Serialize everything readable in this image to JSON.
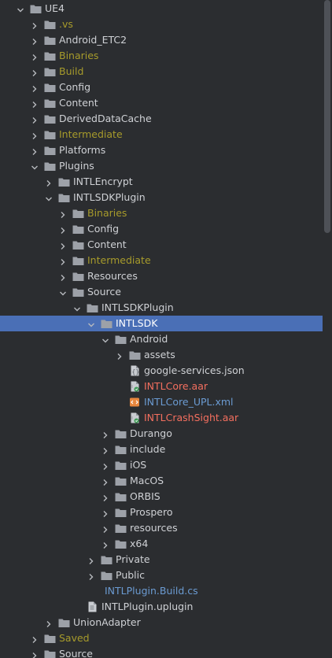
{
  "colors": {
    "background": "#2b2d30",
    "selection": "#4a6fb6",
    "text_default": "#cfd1d5",
    "text_excluded": "#a79b2b",
    "text_added": "#f46f5f",
    "text_modified": "#6b9bd2",
    "folder": "#9da1a8"
  },
  "tree": [
    {
      "label": "UE4",
      "level": 0,
      "expanded": true,
      "kind": "folder",
      "status": "default"
    },
    {
      "label": ".vs",
      "level": 1,
      "expanded": false,
      "kind": "folder",
      "status": "excluded"
    },
    {
      "label": "Android_ETC2",
      "level": 1,
      "expanded": false,
      "kind": "folder",
      "status": "default"
    },
    {
      "label": "Binaries",
      "level": 1,
      "expanded": false,
      "kind": "folder",
      "status": "excluded"
    },
    {
      "label": "Build",
      "level": 1,
      "expanded": false,
      "kind": "folder",
      "status": "excluded"
    },
    {
      "label": "Config",
      "level": 1,
      "expanded": false,
      "kind": "folder",
      "status": "default"
    },
    {
      "label": "Content",
      "level": 1,
      "expanded": false,
      "kind": "folder",
      "status": "default"
    },
    {
      "label": "DerivedDataCache",
      "level": 1,
      "expanded": false,
      "kind": "folder",
      "status": "default"
    },
    {
      "label": "Intermediate",
      "level": 1,
      "expanded": false,
      "kind": "folder",
      "status": "excluded"
    },
    {
      "label": "Platforms",
      "level": 1,
      "expanded": false,
      "kind": "folder",
      "status": "default"
    },
    {
      "label": "Plugins",
      "level": 1,
      "expanded": true,
      "kind": "folder",
      "status": "default"
    },
    {
      "label": "INTLEncrypt",
      "level": 2,
      "expanded": false,
      "kind": "folder",
      "status": "default"
    },
    {
      "label": "INTLSDKPlugin",
      "level": 2,
      "expanded": true,
      "kind": "folder",
      "status": "default"
    },
    {
      "label": "Binaries",
      "level": 3,
      "expanded": false,
      "kind": "folder",
      "status": "excluded"
    },
    {
      "label": "Config",
      "level": 3,
      "expanded": false,
      "kind": "folder",
      "status": "default"
    },
    {
      "label": "Content",
      "level": 3,
      "expanded": false,
      "kind": "folder",
      "status": "default"
    },
    {
      "label": "Intermediate",
      "level": 3,
      "expanded": false,
      "kind": "folder",
      "status": "excluded"
    },
    {
      "label": "Resources",
      "level": 3,
      "expanded": false,
      "kind": "folder",
      "status": "default"
    },
    {
      "label": "Source",
      "level": 3,
      "expanded": true,
      "kind": "folder",
      "status": "default"
    },
    {
      "label": "INTLSDKPlugin",
      "level": 4,
      "expanded": true,
      "kind": "folder",
      "status": "default"
    },
    {
      "label": "INTLSDK",
      "level": 5,
      "expanded": true,
      "kind": "folder",
      "status": "default",
      "selected": true
    },
    {
      "label": "Android",
      "level": 6,
      "expanded": true,
      "kind": "folder",
      "status": "default"
    },
    {
      "label": "assets",
      "level": 7,
      "expanded": false,
      "kind": "folder",
      "status": "default"
    },
    {
      "label": "google-services.json",
      "level": 7,
      "kind": "json",
      "status": "default"
    },
    {
      "label": "INTLCore.aar",
      "level": 7,
      "kind": "aar",
      "status": "added"
    },
    {
      "label": "INTLCore_UPL.xml",
      "level": 7,
      "kind": "xml",
      "status": "modified"
    },
    {
      "label": "INTLCrashSight.aar",
      "level": 7,
      "kind": "aar",
      "status": "added"
    },
    {
      "label": "Durango",
      "level": 6,
      "expanded": false,
      "kind": "folder",
      "status": "default"
    },
    {
      "label": "include",
      "level": 6,
      "expanded": false,
      "kind": "folder",
      "status": "default"
    },
    {
      "label": "iOS",
      "level": 6,
      "expanded": false,
      "kind": "folder",
      "status": "default"
    },
    {
      "label": "MacOS",
      "level": 6,
      "expanded": false,
      "kind": "folder",
      "status": "default"
    },
    {
      "label": "ORBIS",
      "level": 6,
      "expanded": false,
      "kind": "folder",
      "status": "default"
    },
    {
      "label": "Prospero",
      "level": 6,
      "expanded": false,
      "kind": "folder",
      "status": "default"
    },
    {
      "label": "resources",
      "level": 6,
      "expanded": false,
      "kind": "folder",
      "status": "default"
    },
    {
      "label": "x64",
      "level": 6,
      "expanded": false,
      "kind": "folder",
      "status": "default"
    },
    {
      "label": "Private",
      "level": 5,
      "expanded": false,
      "kind": "folder",
      "status": "default"
    },
    {
      "label": "Public",
      "level": 5,
      "expanded": false,
      "kind": "folder",
      "status": "default"
    },
    {
      "label": "INTLPlugin.Build.cs",
      "level": 5,
      "kind": "cs",
      "status": "modified"
    },
    {
      "label": "INTLPlugin.uplugin",
      "level": 4,
      "kind": "file",
      "status": "default"
    },
    {
      "label": "UnionAdapter",
      "level": 2,
      "expanded": false,
      "kind": "folder",
      "status": "default"
    },
    {
      "label": "Saved",
      "level": 1,
      "expanded": false,
      "kind": "folder",
      "status": "excluded"
    },
    {
      "label": "Source",
      "level": 1,
      "expanded": false,
      "kind": "folder",
      "status": "default"
    }
  ]
}
